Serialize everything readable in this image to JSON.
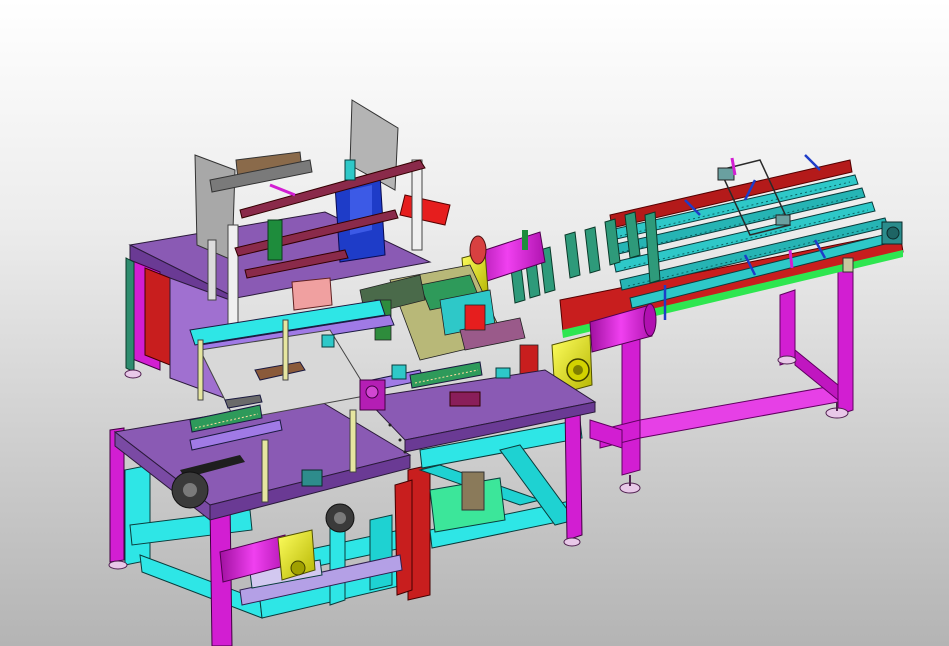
{
  "viewport": {
    "title": "",
    "background_top": "#ffffff",
    "background_bottom": "#b4b4b4"
  },
  "model": {
    "description_colors": {
      "frame_magenta": "#e61ee6",
      "frame_cyan": "#2ee6e6",
      "table_purple": "#8a5ab4",
      "rail_red": "#c81e1e",
      "motor_yellow": "#e6e61e",
      "bracket_blue": "#1e3cc8",
      "plate_grey": "#d2d2d2",
      "guide_green": "#1e8c3c",
      "accent_salmon": "#f0a0a0"
    }
  }
}
